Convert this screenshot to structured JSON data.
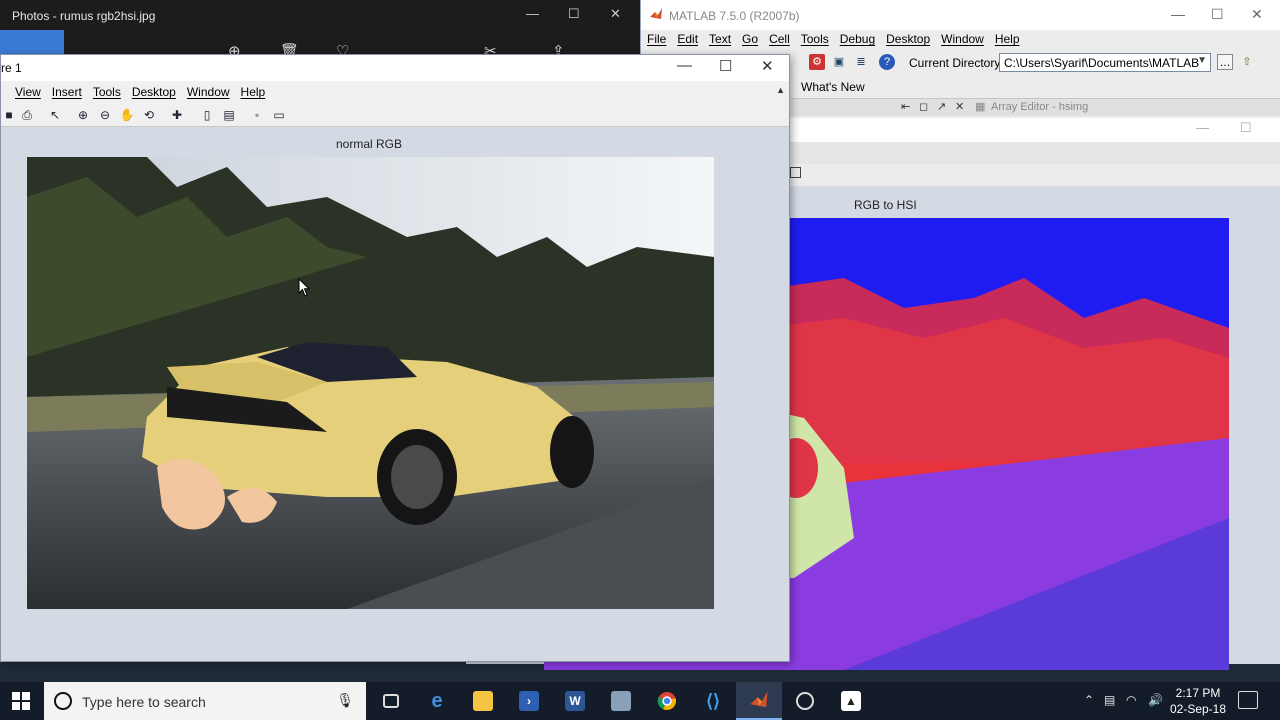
{
  "photos": {
    "title": "Photos - rumus rgb2hsi.jpg",
    "controls": [
      "—",
      "☐",
      "✕"
    ],
    "toolbar_icons": [
      "⊕",
      "🗑",
      "♡",
      "✎",
      "✂",
      "⇪"
    ]
  },
  "matlab": {
    "title": "MATLAB  7.5.0 (R2007b)",
    "menu": [
      "File",
      "Edit",
      "Text",
      "Go",
      "Cell",
      "Tools",
      "Debug",
      "Desktop",
      "Window",
      "Help"
    ],
    "current_directory_label": "Current Directory:",
    "current_directory_value": "C:\\Users\\Syarif\\Documents\\MATLAB",
    "whats_new": "What's New",
    "array_editor": "Array Editor - hsimg"
  },
  "figure1": {
    "title": "re 1",
    "menu": [
      "View",
      "Insert",
      "Tools",
      "Desktop",
      "Window",
      "Help"
    ],
    "axes_title": "normal RGB"
  },
  "figure2": {
    "axes_title": "RGB to HSI"
  },
  "taskbar": {
    "search_placeholder": "Type here to search",
    "time": "2:17 PM",
    "date": "02-Sep-18"
  }
}
